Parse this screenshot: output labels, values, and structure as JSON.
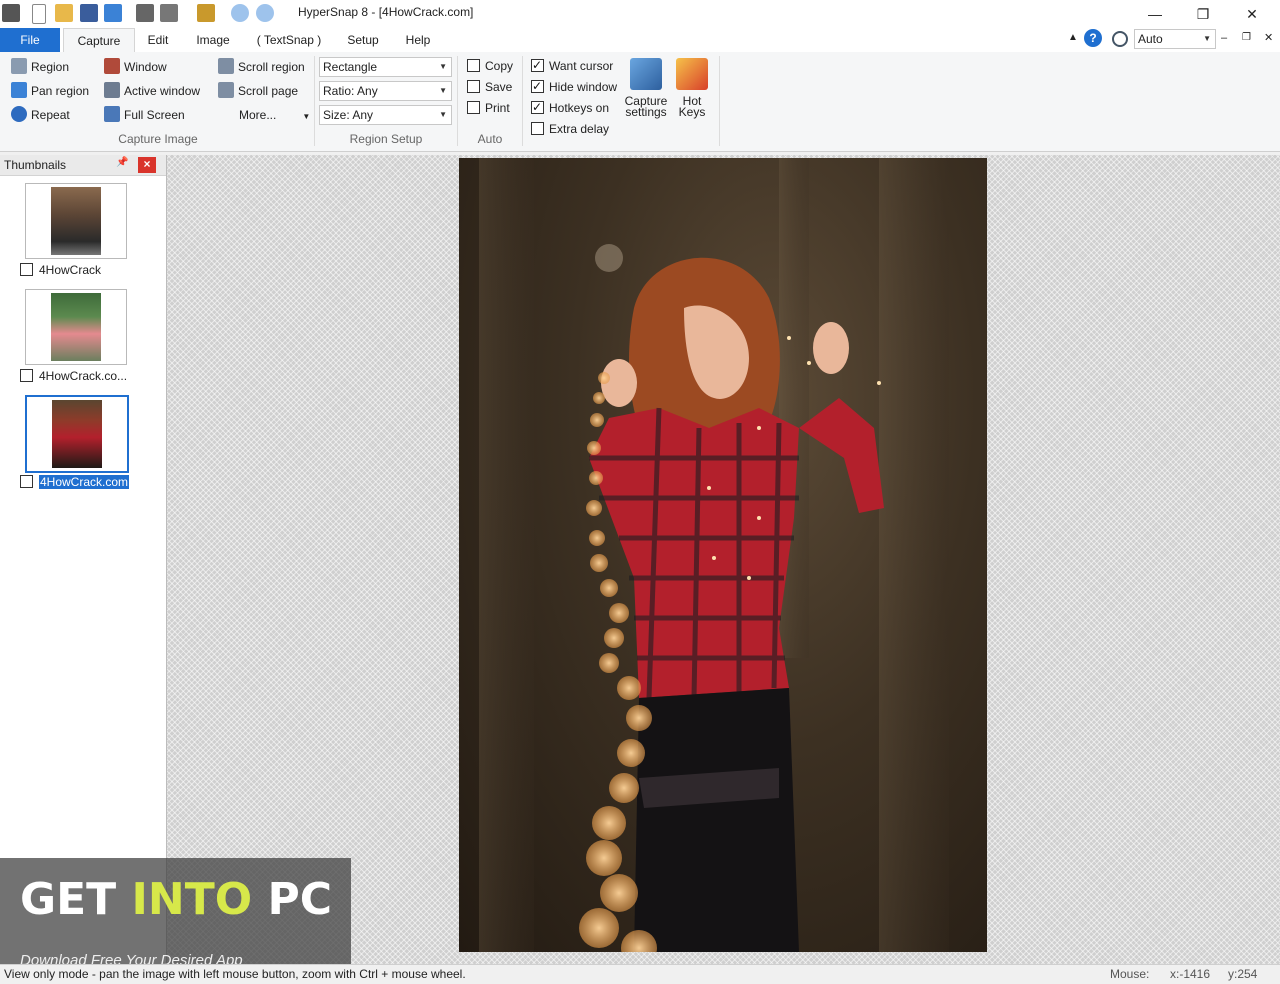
{
  "window": {
    "title": "HyperSnap 8 - [4HowCrack.com]",
    "minimize_glyph": "—",
    "restore_glyph": "❐",
    "close_glyph": "✕"
  },
  "menu": {
    "tabs": [
      "File",
      "Capture",
      "Edit",
      "Image",
      "( TextSnap )",
      "Setup",
      "Help"
    ],
    "active_tab": "Capture",
    "zoom_value": "Auto",
    "help_glyph": "?"
  },
  "ribbon": {
    "capture_image": {
      "label": "Capture Image",
      "col1": [
        "Region",
        "Pan region",
        "Repeat"
      ],
      "col2": [
        "Window",
        "Active window",
        "Full Screen"
      ],
      "col3": [
        "Scroll region",
        "Scroll page",
        "More..."
      ]
    },
    "region_setup": {
      "label": "Region Setup",
      "shape": "Rectangle",
      "ratio": "Ratio: Any",
      "size": "Size: Any"
    },
    "auto": {
      "label": "Auto",
      "items": [
        {
          "label": "Copy",
          "checked": false
        },
        {
          "label": "Save",
          "checked": false
        },
        {
          "label": "Print",
          "checked": false
        }
      ]
    },
    "options": {
      "items": [
        {
          "label": "Want cursor",
          "checked": true
        },
        {
          "label": "Hide window",
          "checked": true
        },
        {
          "label": "Hotkeys on",
          "checked": true
        },
        {
          "label": "Extra delay",
          "checked": false
        }
      ]
    },
    "capture_settings": {
      "line1": "Capture",
      "line2": "settings"
    },
    "hot_keys": {
      "line1": "Hot",
      "line2": "Keys"
    }
  },
  "thumbnails": {
    "title": "Thumbnails",
    "pin_glyph": "📌",
    "close_glyph": "×",
    "items": [
      {
        "label": "4HowCrack",
        "selected": false
      },
      {
        "label": "4HowCrack.co...",
        "selected": false
      },
      {
        "label": "4HowCrack.com",
        "selected": true
      }
    ]
  },
  "watermark": {
    "brand_a": "GET ",
    "brand_b": "INTO",
    "brand_c": " PC",
    "tagline": "Download Free Your Desired App"
  },
  "status": {
    "message": "View only mode - pan the image with left mouse button, zoom with Ctrl + mouse wheel.",
    "mouse_label": "Mouse:",
    "x": "x:-1416",
    "y": "y:254"
  },
  "colors": {
    "accent": "#1f6fd0",
    "shirt_red": "#b3202c",
    "hair": "#9c4a22",
    "bokeh": "#f2b36a"
  }
}
